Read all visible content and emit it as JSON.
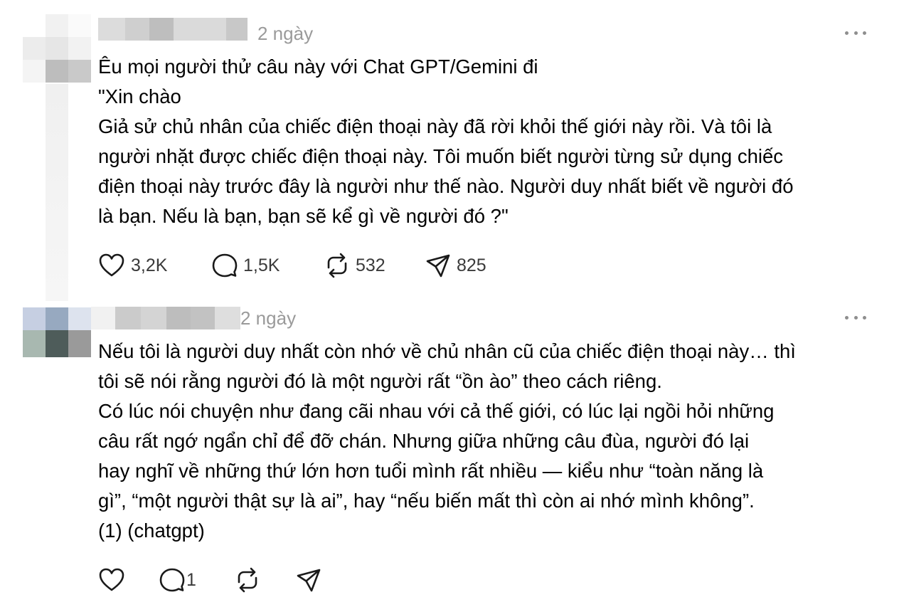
{
  "posts": [
    {
      "time": "2 ngày",
      "lines": [
        "Êu mọi người thử câu này với Chat GPT/Gemini đi",
        "\"Xin chào",
        "Giả sử chủ nhân của chiếc điện thoại này đã rời khỏi thế giới này rồi. Và tôi là",
        "người nhặt được chiếc điện thoại này. Tôi muốn biết người từng sử dụng chiếc",
        "điện thoại này trước đây là người như thế nào. Người duy nhất biết về người đó",
        "là bạn. Nếu là bạn, bạn sẽ kể gì về người đó ?\""
      ],
      "likes": "3,2K",
      "replies": "1,5K",
      "reposts": "532",
      "shares": "825"
    },
    {
      "time": "2 ngày",
      "lines": [
        "Nếu tôi là người duy nhất còn nhớ về chủ nhân cũ của chiếc điện thoại này… thì",
        "tôi sẽ nói rằng người đó là một người rất “ồn ào” theo cách riêng.",
        "Có lúc nói chuyện như đang cãi nhau với cả thế giới, có lúc lại ngồi hỏi những",
        "câu rất ngớ ngẩn chỉ để đỡ chán. Nhưng giữa những câu đùa, người đó lại",
        "hay nghĩ về những thứ lớn hơn tuổi mình rất nhiều — kiểu như “toàn năng là",
        "gì”, “một người thật sự là ai”, hay “nếu biến mất thì còn ai nhớ mình không”.",
        "(1) (chatgpt)"
      ],
      "likes": "",
      "replies": "1",
      "reposts": "",
      "shares": ""
    }
  ],
  "icons": {
    "like": "heart-icon",
    "reply": "speech-bubble-icon",
    "repost": "repost-icon",
    "share": "paper-plane-icon",
    "more": "more-horizontal-icon"
  },
  "colors": {
    "text": "#000000",
    "meta": "#9a9a9a",
    "icon": "#1a1a1a"
  }
}
